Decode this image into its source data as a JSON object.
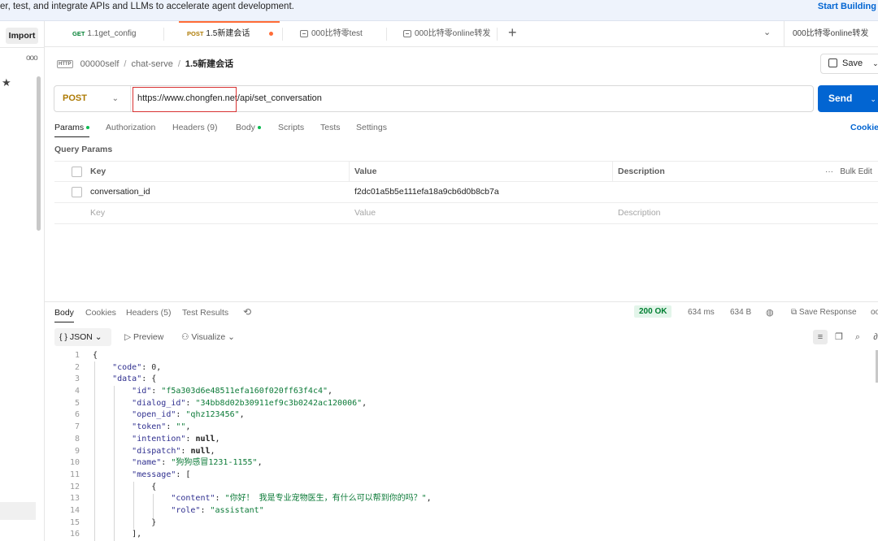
{
  "banner": {
    "message": "er, test, and integrate APIs and LLMs to accelerate agent development.",
    "cta": "Start Building"
  },
  "sidebar": {
    "import_label": "Import",
    "more": "ooo",
    "star": "★"
  },
  "tabs": [
    {
      "method": "GET",
      "name": "1.1get_config"
    },
    {
      "method": "POST",
      "name": "1.5新建会话"
    },
    {
      "method": "",
      "name": "000比特零test"
    },
    {
      "method": "",
      "name": "000比特零online转发"
    }
  ],
  "environment": "000比特零online转发",
  "breadcrumb": {
    "workspace": "00000self",
    "collection": "chat-serve",
    "request": "1.5新建会话"
  },
  "save_label": "Save",
  "request": {
    "method": "POST",
    "url": "https://www.chongfen.net/api/set_conversation",
    "send_label": "Send"
  },
  "request_tabs": {
    "params": "Params",
    "authorization": "Authorization",
    "headers": "Headers (9)",
    "body": "Body",
    "scripts": "Scripts",
    "tests": "Tests",
    "settings": "Settings",
    "cookies": "Cookie"
  },
  "query_params": {
    "title": "Query Params",
    "headers": {
      "key": "Key",
      "value": "Value",
      "description": "Description",
      "bulk": "Bulk Edit"
    },
    "rows": [
      {
        "key": "conversation_id",
        "value": "f2dc01a5b5e111efa18a9cb6d0b8cb7a",
        "description": ""
      }
    ],
    "placeholder": {
      "key": "Key",
      "value": "Value",
      "description": "Description"
    }
  },
  "response_tabs": {
    "body": "Body",
    "cookies": "Cookies",
    "headers": "Headers (5)",
    "test_results": "Test Results"
  },
  "response_status": {
    "status": "200 OK",
    "time": "634 ms",
    "size": "634 B",
    "save_response": "Save Response"
  },
  "format": {
    "type": "JSON",
    "preview": "Preview",
    "visualize": "Visualize"
  },
  "code_lines": [
    "1",
    "2",
    "3",
    "4",
    "5",
    "6",
    "7",
    "8",
    "9",
    "10",
    "11",
    "12",
    "13",
    "14",
    "15",
    "16"
  ],
  "response_json": {
    "code": "0",
    "id": "\"f5a303d6e48511efa160f020ff63f4c4\"",
    "dialog_id": "\"34bb8d02b30911ef9c3b0242ac120006\"",
    "open_id": "\"qhz123456\"",
    "token": "\"\"",
    "intention": "null",
    "dispatch": "null",
    "name": "\"狗狗感冒1231-1155\"",
    "content": "\"你好！ 我是专业宠物医生，有什么可以帮到你的吗？\"",
    "role": "\"assistant\""
  }
}
